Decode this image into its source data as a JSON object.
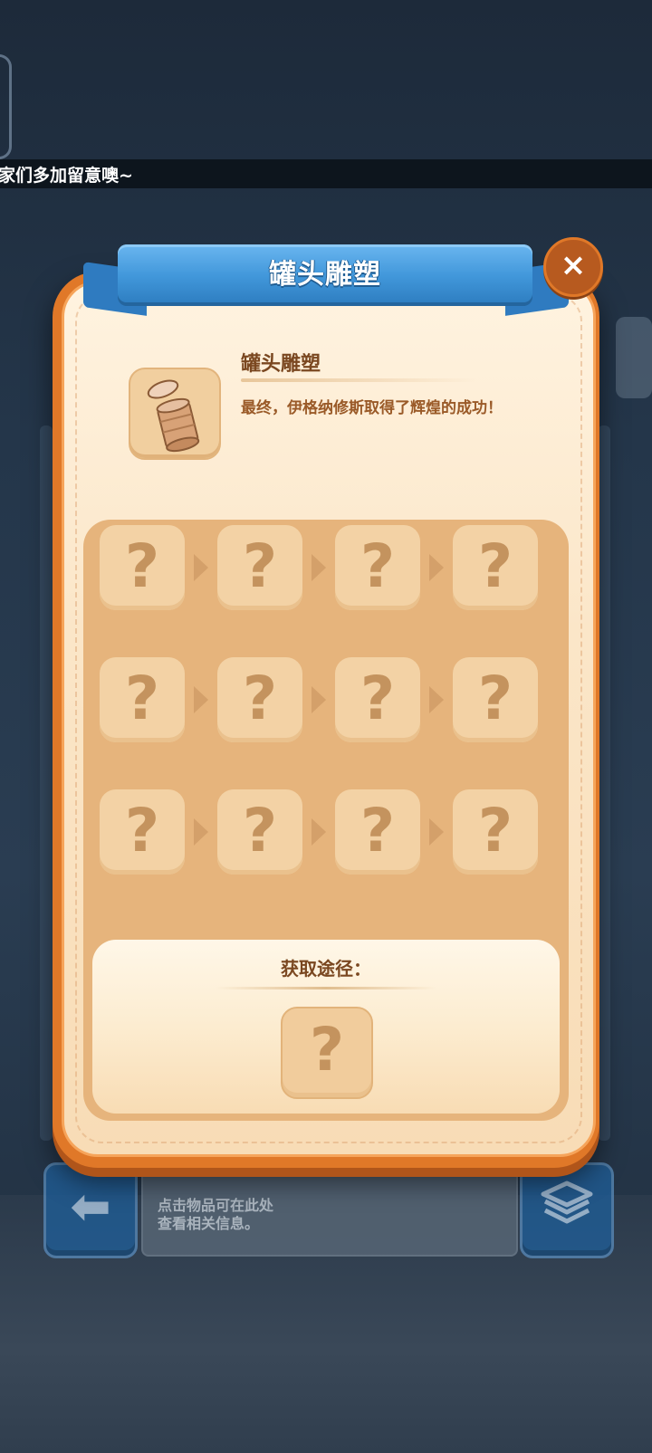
{
  "ticker": {
    "text": "家们多加留意噢~"
  },
  "background": {
    "info_box_text": "点击物品可在此处\n查看相关信息。",
    "back_icon": "left-arrow-icon",
    "box_icon": "open-box-icon"
  },
  "modal": {
    "title": "罐头雕塑",
    "close_icon": "close-icon",
    "close_glyph": "×",
    "item": {
      "name": "罐头雕塑",
      "description": "最终，伊格纳修斯取得了辉煌的成功！",
      "icon": "tin-can-icon"
    },
    "recipe_rows": [
      [
        "?",
        "?",
        "?",
        "?"
      ],
      [
        "?",
        "?",
        "?",
        "?"
      ],
      [
        "?",
        "?",
        "?",
        "?"
      ]
    ],
    "acquisition": {
      "label": "获取途径：",
      "slot": "?"
    }
  },
  "colors": {
    "banner": "#4197da",
    "frame": "#e07828",
    "panel": "#e6b47c",
    "slot": "#f3d2a5",
    "question": "#c4935e"
  }
}
